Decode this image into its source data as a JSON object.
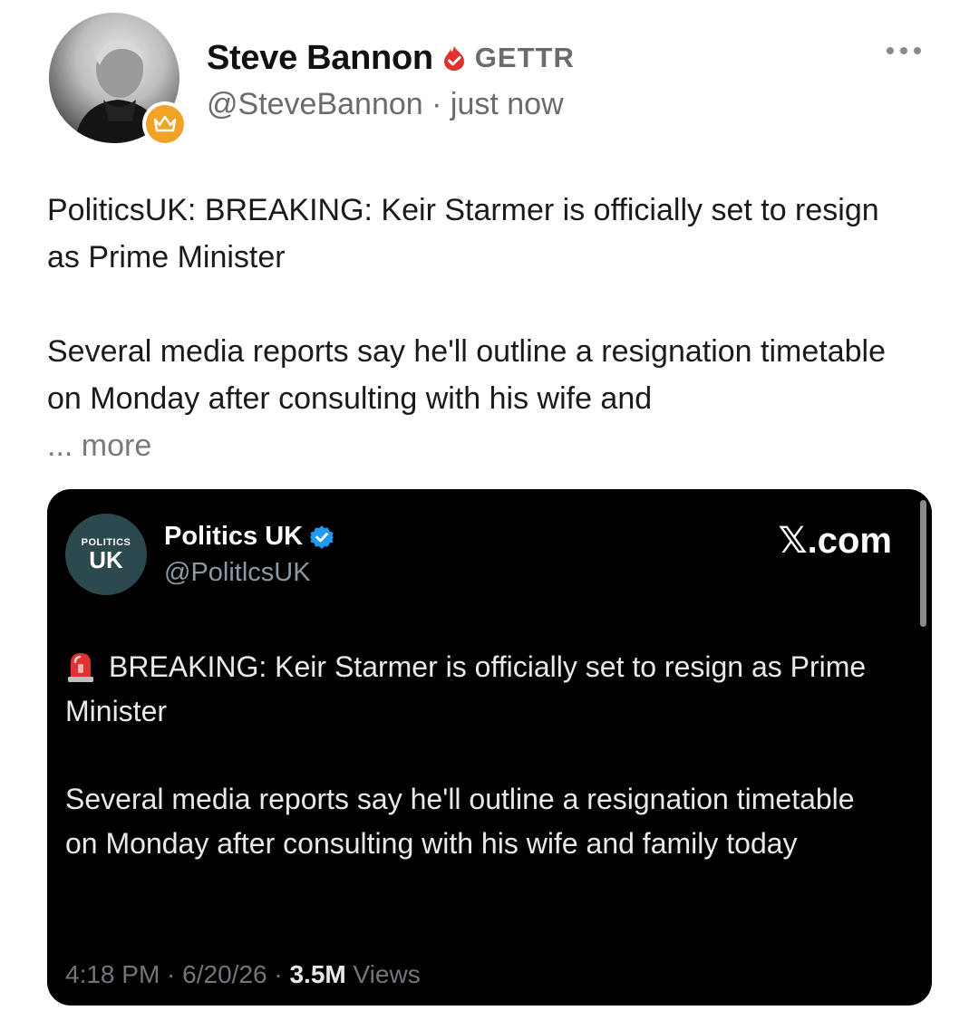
{
  "post": {
    "author_name": "Steve Bannon",
    "platform_label": "GETTR",
    "handle": "@SteveBannon",
    "separator": " · ",
    "time": "just now",
    "body_line1": "PoliticsUK: BREAKING: Keir Starmer is officially set to resign as Prime Minister",
    "body_line2": "Several media reports say he'll outline a resignation timetable on Monday after consulting with his wife and",
    "ellipsis": "... ",
    "more_label": "more"
  },
  "embed": {
    "avatar_small": "POLITICS",
    "avatar_big": "UK",
    "name": "Politics UK",
    "handle": "@PolitlcsUK",
    "source_label": "𝕏.com",
    "body_line1": "BREAKING: Keir Starmer is officially set to resign as Prime Minister",
    "body_line2": "Several media reports say he'll outline a resignation timetable on Monday after consulting with his wife and family today",
    "time": "4:18 PM",
    "sep1": " · ",
    "date": "6/20/26",
    "sep2": " · ",
    "views_count": "3.5M",
    "views_label": " Views"
  },
  "icons": {
    "verified_flame": "flame-verified-icon",
    "crown": "crown-icon",
    "blue_check": "blue-check-icon",
    "siren": "siren-icon",
    "more_menu": "more-dots-icon"
  },
  "colors": {
    "flame_red": "#e0322e",
    "crown_orange": "#f0a326",
    "blue_check": "#1d9bf0",
    "embed_bg": "#000000"
  }
}
